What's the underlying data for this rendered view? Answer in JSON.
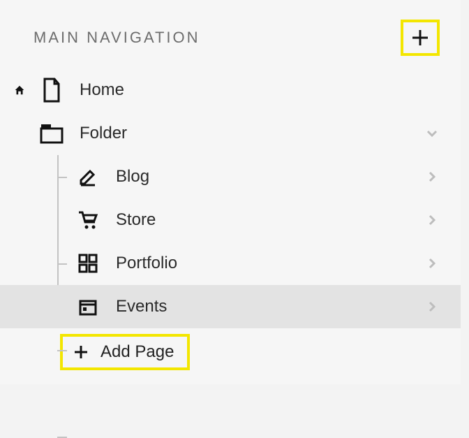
{
  "header": {
    "title": "MAIN NAVIGATION"
  },
  "nav": {
    "home_label": "Home",
    "folder_label": "Folder",
    "children": {
      "blog": "Blog",
      "store": "Store",
      "portfolio": "Portfolio",
      "events": "Events"
    },
    "add_page_label": "Add Page"
  },
  "colors": {
    "highlight": "#f3e600",
    "selected_bg": "#e3e3e3"
  }
}
